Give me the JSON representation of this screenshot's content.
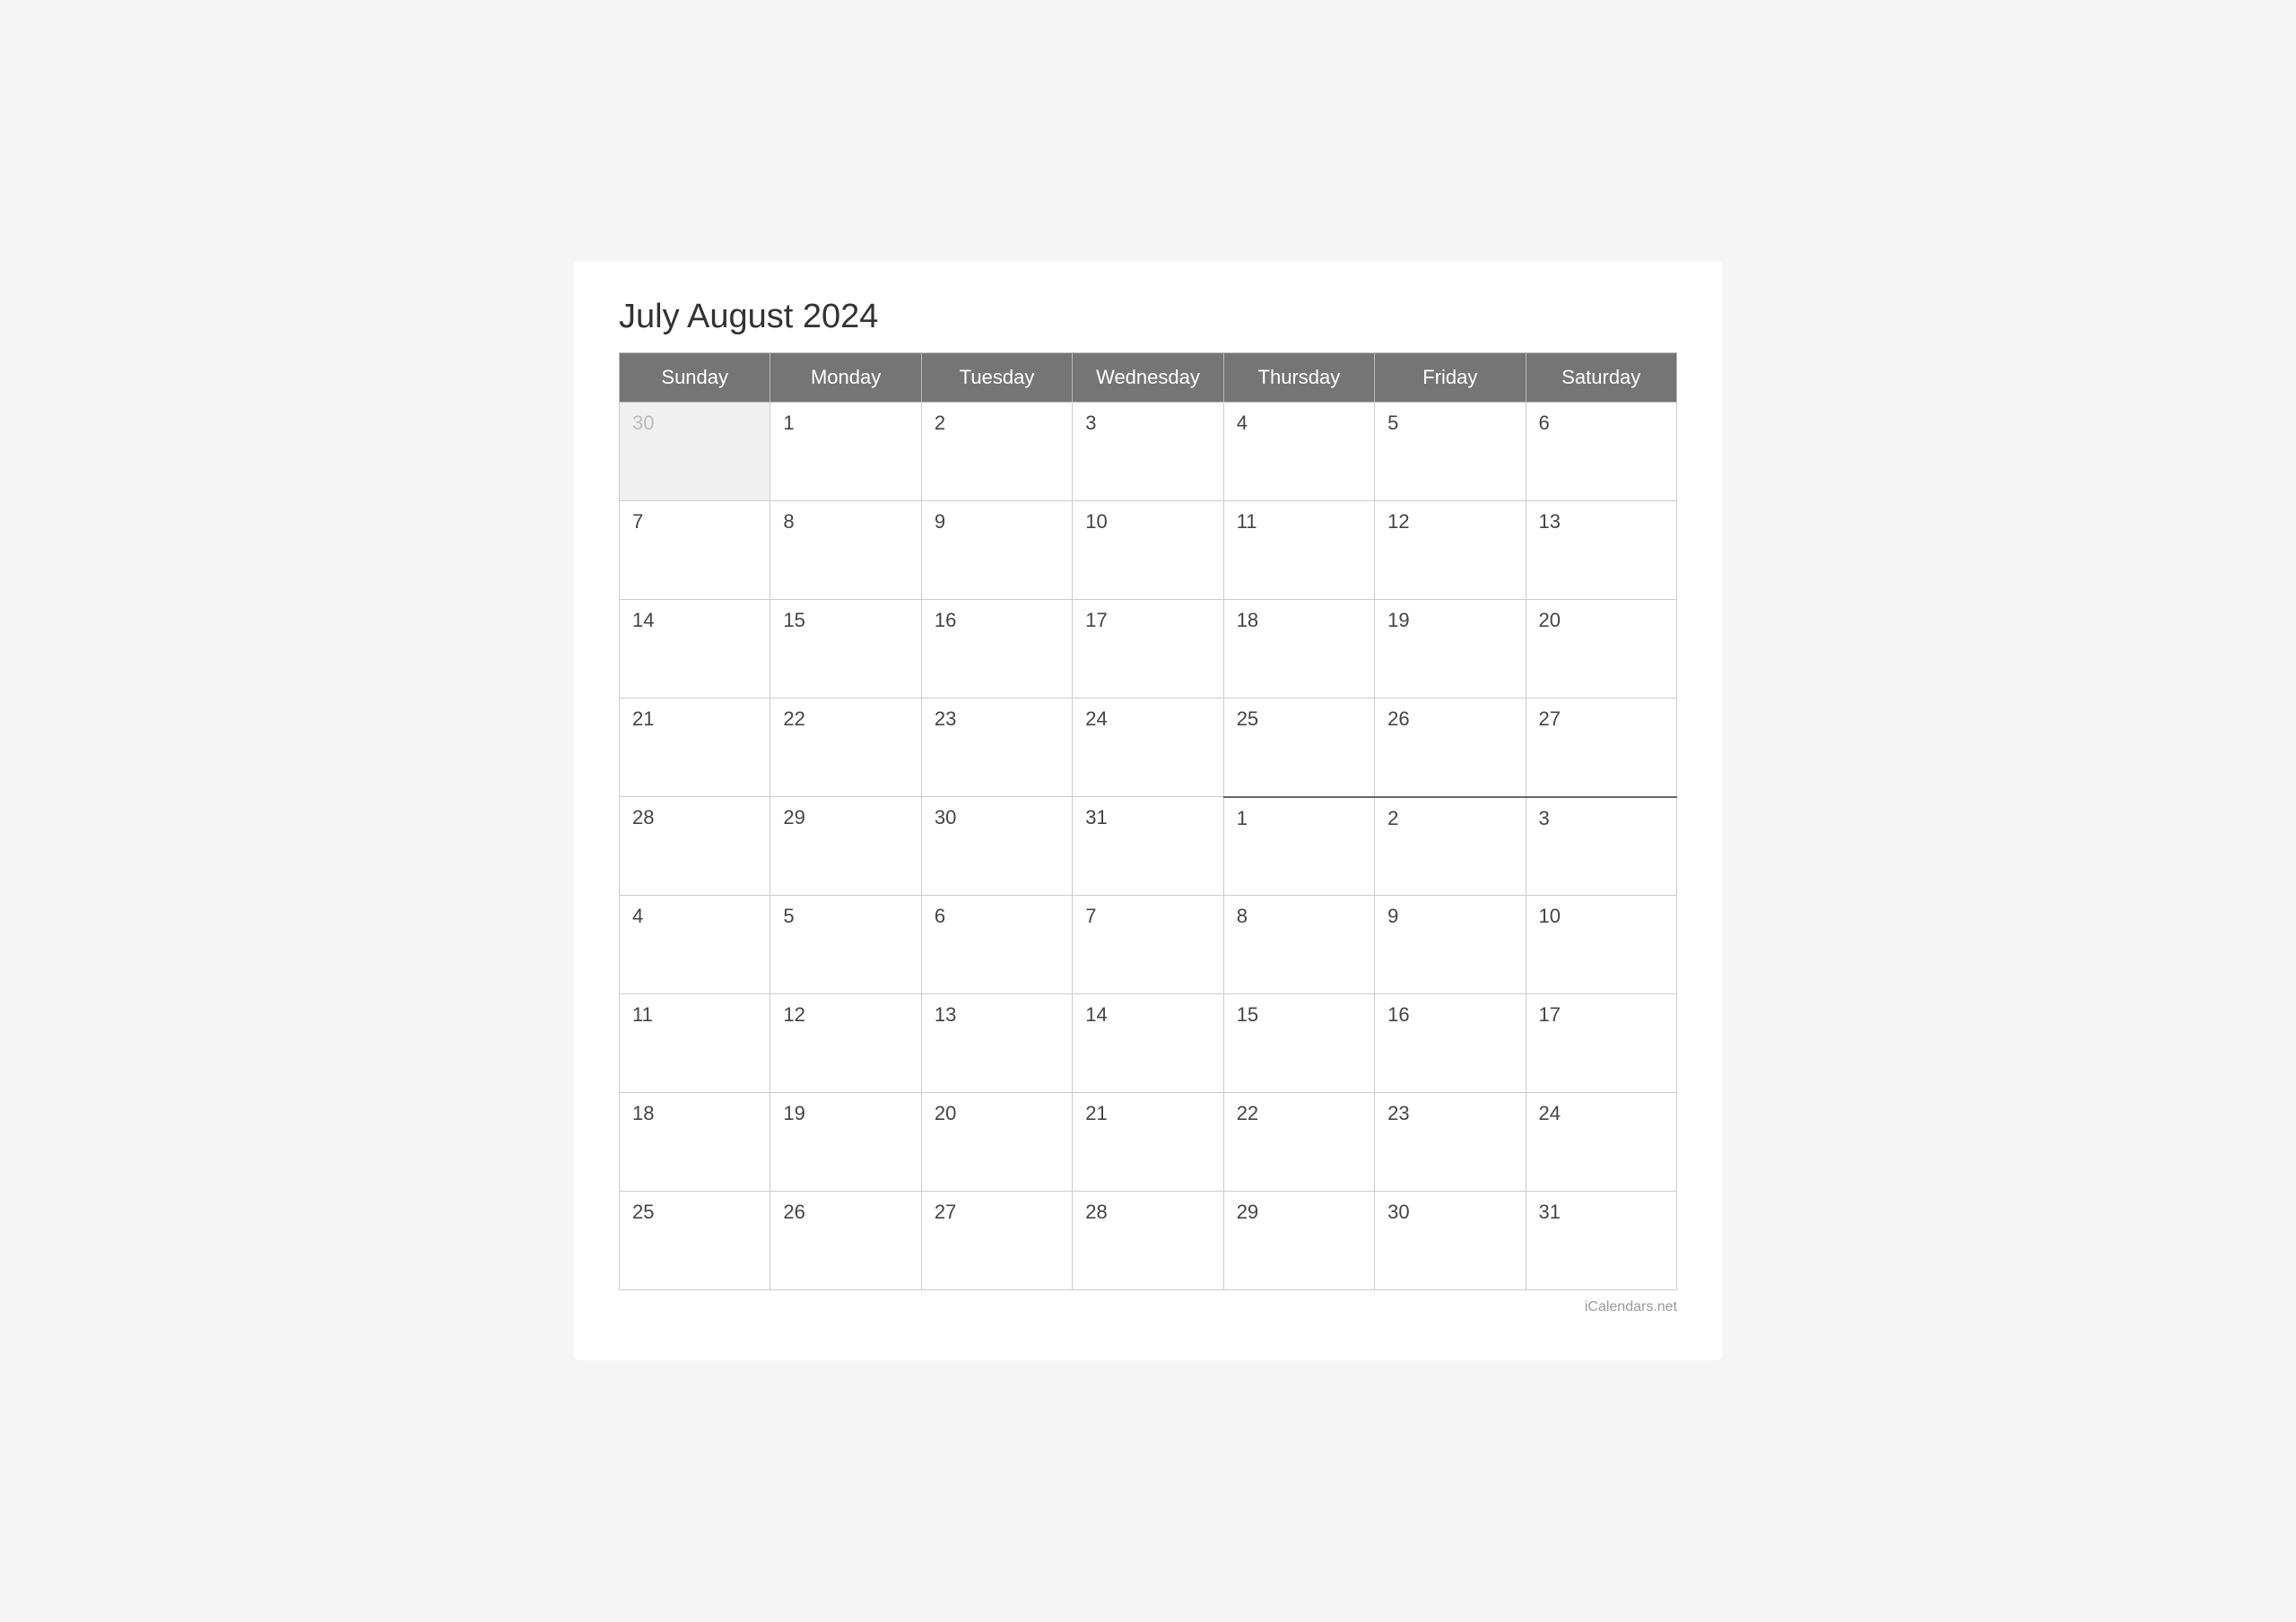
{
  "title": "July August 2024",
  "header": {
    "days": [
      "Sunday",
      "Monday",
      "Tuesday",
      "Wednesday",
      "Thursday",
      "Friday",
      "Saturday"
    ]
  },
  "weeks": [
    {
      "cells": [
        {
          "day": "30",
          "type": "prev-month"
        },
        {
          "day": "1",
          "type": "july"
        },
        {
          "day": "2",
          "type": "july"
        },
        {
          "day": "3",
          "type": "july"
        },
        {
          "day": "4",
          "type": "july"
        },
        {
          "day": "5",
          "type": "july"
        },
        {
          "day": "6",
          "type": "july"
        }
      ]
    },
    {
      "cells": [
        {
          "day": "7",
          "type": "july"
        },
        {
          "day": "8",
          "type": "july"
        },
        {
          "day": "9",
          "type": "july"
        },
        {
          "day": "10",
          "type": "july"
        },
        {
          "day": "11",
          "type": "july"
        },
        {
          "day": "12",
          "type": "july"
        },
        {
          "day": "13",
          "type": "july"
        }
      ]
    },
    {
      "cells": [
        {
          "day": "14",
          "type": "july"
        },
        {
          "day": "15",
          "type": "july"
        },
        {
          "day": "16",
          "type": "july"
        },
        {
          "day": "17",
          "type": "july"
        },
        {
          "day": "18",
          "type": "july"
        },
        {
          "day": "19",
          "type": "july"
        },
        {
          "day": "20",
          "type": "july"
        }
      ]
    },
    {
      "cells": [
        {
          "day": "21",
          "type": "july"
        },
        {
          "day": "22",
          "type": "july"
        },
        {
          "day": "23",
          "type": "july"
        },
        {
          "day": "24",
          "type": "july"
        },
        {
          "day": "25",
          "type": "july"
        },
        {
          "day": "26",
          "type": "july"
        },
        {
          "day": "27",
          "type": "july"
        }
      ]
    },
    {
      "cells": [
        {
          "day": "28",
          "type": "july"
        },
        {
          "day": "29",
          "type": "july"
        },
        {
          "day": "30",
          "type": "july"
        },
        {
          "day": "31",
          "type": "july"
        },
        {
          "day": "1",
          "type": "aug-start"
        },
        {
          "day": "2",
          "type": "aug-start"
        },
        {
          "day": "3",
          "type": "aug-start"
        }
      ]
    },
    {
      "cells": [
        {
          "day": "4",
          "type": "august"
        },
        {
          "day": "5",
          "type": "august"
        },
        {
          "day": "6",
          "type": "august"
        },
        {
          "day": "7",
          "type": "august"
        },
        {
          "day": "8",
          "type": "august"
        },
        {
          "day": "9",
          "type": "august"
        },
        {
          "day": "10",
          "type": "august"
        }
      ]
    },
    {
      "cells": [
        {
          "day": "11",
          "type": "august"
        },
        {
          "day": "12",
          "type": "august"
        },
        {
          "day": "13",
          "type": "august"
        },
        {
          "day": "14",
          "type": "august"
        },
        {
          "day": "15",
          "type": "august"
        },
        {
          "day": "16",
          "type": "august"
        },
        {
          "day": "17",
          "type": "august"
        }
      ]
    },
    {
      "cells": [
        {
          "day": "18",
          "type": "august"
        },
        {
          "day": "19",
          "type": "august"
        },
        {
          "day": "20",
          "type": "august"
        },
        {
          "day": "21",
          "type": "august"
        },
        {
          "day": "22",
          "type": "august"
        },
        {
          "day": "23",
          "type": "august"
        },
        {
          "day": "24",
          "type": "august"
        }
      ]
    },
    {
      "cells": [
        {
          "day": "25",
          "type": "august"
        },
        {
          "day": "26",
          "type": "august"
        },
        {
          "day": "27",
          "type": "august"
        },
        {
          "day": "28",
          "type": "august"
        },
        {
          "day": "29",
          "type": "august"
        },
        {
          "day": "30",
          "type": "august"
        },
        {
          "day": "31",
          "type": "august"
        }
      ]
    }
  ],
  "watermark": "iCalendars.net"
}
